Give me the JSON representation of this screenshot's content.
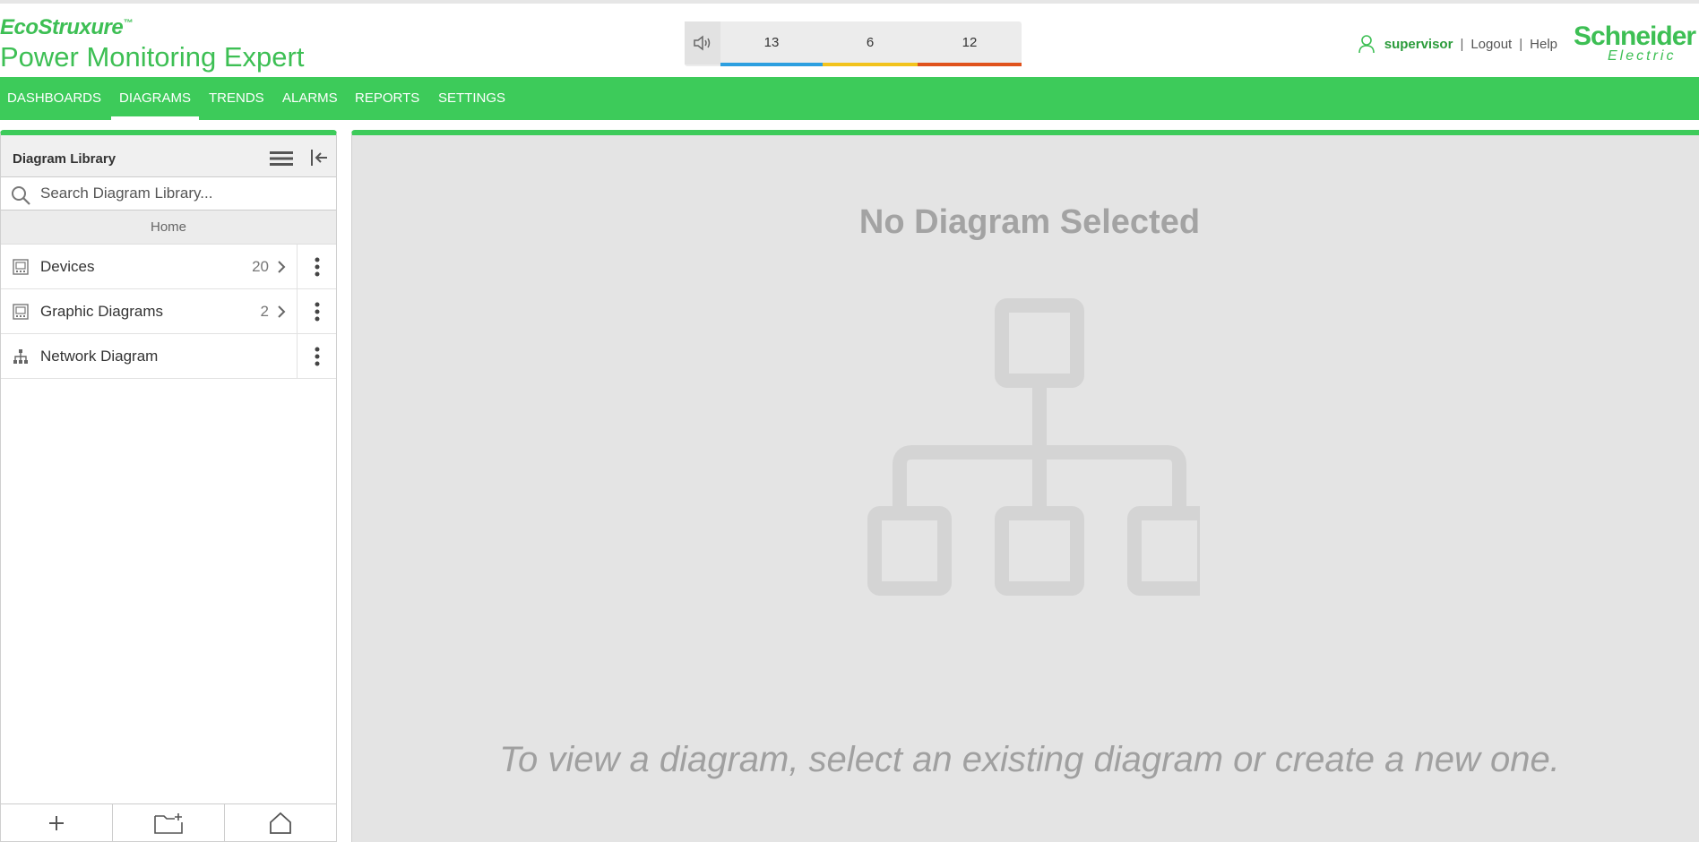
{
  "branding": {
    "suite": "EcoStruxure",
    "product": "Power Monitoring Expert",
    "vendor_line1": "Schneider",
    "vendor_line2": "Electric"
  },
  "alarms": {
    "segments": [
      {
        "count": "13",
        "color": "#2c9fe0"
      },
      {
        "count": "6",
        "color": "#f2c31c"
      },
      {
        "count": "12",
        "color": "#e0521c"
      }
    ]
  },
  "user": {
    "name": "supervisor",
    "logout": "Logout",
    "help": "Help",
    "separator": "|"
  },
  "nav": {
    "items": [
      {
        "label": "DASHBOARDS"
      },
      {
        "label": "DIAGRAMS",
        "active": true
      },
      {
        "label": "TRENDS"
      },
      {
        "label": "ALARMS"
      },
      {
        "label": "REPORTS"
      },
      {
        "label": "SETTINGS"
      }
    ]
  },
  "library": {
    "title": "Diagram Library",
    "search_placeholder": "Search Diagram Library...",
    "breadcrumb": "Home",
    "rows": [
      {
        "label": "Devices",
        "count": "20",
        "icon": "device-icon"
      },
      {
        "label": "Graphic Diagrams",
        "count": "2",
        "icon": "device-icon"
      },
      {
        "label": "Network Diagram",
        "count": "",
        "icon": "network-icon"
      }
    ]
  },
  "main": {
    "empty_title": "No Diagram Selected",
    "empty_message": "To view a diagram, select an existing diagram or create a new one."
  },
  "colors": {
    "accent_green": "#3dcb5a",
    "brand_green": "#3dbf54"
  }
}
